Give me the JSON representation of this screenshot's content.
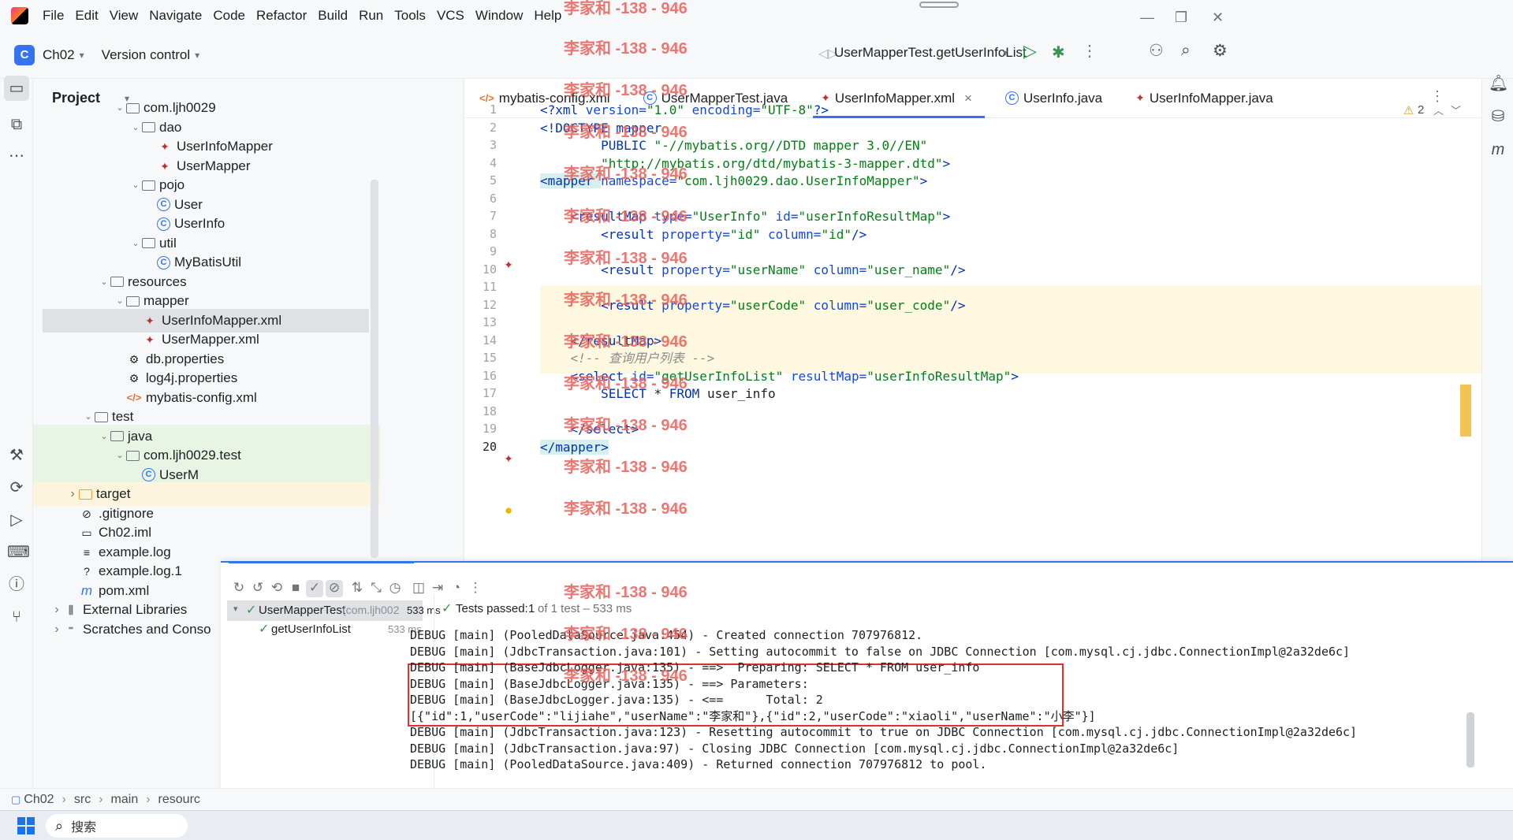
{
  "menu": [
    "File",
    "Edit",
    "View",
    "Navigate",
    "Code",
    "Refactor",
    "Build",
    "Run",
    "Tools",
    "VCS",
    "Window",
    "Help"
  ],
  "toolbar": {
    "project_badge": "C",
    "project_name": "Ch02",
    "version_control": "Version control",
    "run_config": "UserMapperTest.getUserInfoList"
  },
  "project_panel": {
    "title": "Project",
    "tree": [
      {
        "label": "com.ljh0029",
        "icon": "package",
        "arrow": "down"
      },
      {
        "label": "dao",
        "icon": "package",
        "arrow": "down"
      },
      {
        "label": "UserInfoMapper",
        "icon": "mybatis",
        "arrow": ""
      },
      {
        "label": "UserMapper",
        "icon": "mybatis",
        "arrow": ""
      },
      {
        "label": "pojo",
        "icon": "package",
        "arrow": "down"
      },
      {
        "label": "User",
        "icon": "class",
        "arrow": ""
      },
      {
        "label": "UserInfo",
        "icon": "class",
        "arrow": ""
      },
      {
        "label": "util",
        "icon": "package",
        "arrow": "down"
      },
      {
        "label": "MyBatisUtil",
        "icon": "class",
        "arrow": ""
      },
      {
        "label": "resources",
        "icon": "folder",
        "arrow": "down"
      },
      {
        "label": "mapper",
        "icon": "folder",
        "arrow": "down"
      },
      {
        "label": "UserInfoMapper.xml",
        "icon": "mybatis",
        "arrow": ""
      },
      {
        "label": "UserMapper.xml",
        "icon": "mybatis",
        "arrow": ""
      },
      {
        "label": "db.properties",
        "icon": "gear",
        "arrow": ""
      },
      {
        "label": "log4j.properties",
        "icon": "gear",
        "arrow": ""
      },
      {
        "label": "mybatis-config.xml",
        "icon": "xml",
        "arrow": ""
      },
      {
        "label": "test",
        "icon": "folder",
        "arrow": "down"
      },
      {
        "label": "java",
        "icon": "folder",
        "arrow": "down"
      },
      {
        "label": "com.ljh0029.test",
        "icon": "package",
        "arrow": "down"
      },
      {
        "label": "UserM",
        "icon": "class",
        "arrow": ""
      },
      {
        "label": "target",
        "icon": "folder-orange",
        "arrow": "right"
      },
      {
        "label": ".gitignore",
        "icon": "ignore",
        "arrow": ""
      },
      {
        "label": "Ch02.iml",
        "icon": "file",
        "arrow": ""
      },
      {
        "label": "example.log",
        "icon": "lines",
        "arrow": ""
      },
      {
        "label": "example.log.1",
        "icon": "unknown",
        "arrow": ""
      },
      {
        "label": "pom.xml",
        "icon": "maven",
        "arrow": ""
      },
      {
        "label": "External Libraries",
        "icon": "library",
        "arrow": "right"
      },
      {
        "label": "Scratches and Conso",
        "icon": "scratch",
        "arrow": "right"
      }
    ]
  },
  "tabs": [
    {
      "label": "mybatis-config.xml",
      "icon": "</>"
    },
    {
      "label": "UserMapperTest.java",
      "icon": "C"
    },
    {
      "label": "UserInfoMapper.xml",
      "icon": "bird",
      "active": true,
      "close": "×"
    },
    {
      "label": "UserInfo.java",
      "icon": "C"
    },
    {
      "label": "UserInfoMapper.java",
      "icon": "bird"
    }
  ],
  "inspection": {
    "count": "2"
  },
  "code": [
    {
      "n": "1",
      "parts": [
        [
          "t-tag",
          "<?xml "
        ],
        [
          "t-attr",
          "version="
        ],
        [
          "t-val",
          "\"1.0\" "
        ],
        [
          "t-attr",
          "encoding="
        ],
        [
          "t-val",
          "\"UTF-8\""
        ],
        [
          "t-tag",
          "?>"
        ]
      ]
    },
    {
      "n": "2",
      "parts": [
        [
          "t-tag",
          "<!DOCTYPE mapper"
        ]
      ]
    },
    {
      "n": "3",
      "parts": [
        [
          "",
          "        "
        ],
        [
          "t-tag",
          "PUBLIC "
        ],
        [
          "t-val",
          "\"-//mybatis.org//DTD mapper 3.0//EN\""
        ]
      ]
    },
    {
      "n": "4",
      "parts": [
        [
          "",
          "        "
        ],
        [
          "t-val",
          "\"http://mybatis.org/dtd/mybatis-3-mapper.dtd\""
        ],
        [
          "t-tag",
          ">"
        ]
      ]
    },
    {
      "n": "5",
      "parts": [
        [
          "t-tag",
          "<mapper "
        ],
        [
          "t-attr",
          "namespace="
        ],
        [
          "t-val",
          "\"com.ljh0029.dao.UserInfoMapper\""
        ],
        [
          "t-tag",
          ">"
        ]
      ]
    },
    {
      "n": "6",
      "parts": []
    },
    {
      "n": "7",
      "parts": [
        [
          "",
          "    "
        ],
        [
          "t-tag",
          "<resultMap "
        ],
        [
          "t-attr",
          "type="
        ],
        [
          "t-val",
          "\"UserInfo\" "
        ],
        [
          "t-attr",
          "id="
        ],
        [
          "t-val",
          "\"userInfoResultMap\""
        ],
        [
          "t-tag",
          ">"
        ]
      ]
    },
    {
      "n": "8",
      "parts": [
        [
          "",
          "        "
        ],
        [
          "t-tag",
          "<result "
        ],
        [
          "t-attr",
          "property="
        ],
        [
          "t-val",
          "\"id\" "
        ],
        [
          "t-attr",
          "column="
        ],
        [
          "t-val",
          "\"id\""
        ],
        [
          "t-tag",
          "/>"
        ]
      ]
    },
    {
      "n": "9",
      "parts": []
    },
    {
      "n": "10",
      "parts": [
        [
          "",
          "        "
        ],
        [
          "t-tag",
          "<result "
        ],
        [
          "t-attr",
          "property="
        ],
        [
          "t-val",
          "\"userName\" "
        ],
        [
          "t-attr",
          "column="
        ],
        [
          "t-val",
          "\"user_name\""
        ],
        [
          "t-tag",
          "/>"
        ]
      ]
    },
    {
      "n": "11",
      "parts": []
    },
    {
      "n": "12",
      "parts": [
        [
          "",
          "        "
        ],
        [
          "t-tag",
          "<result "
        ],
        [
          "t-attr",
          "property="
        ],
        [
          "t-val",
          "\"userCode\" "
        ],
        [
          "t-attr",
          "column="
        ],
        [
          "t-val",
          "\"user_code\""
        ],
        [
          "t-tag",
          "/>"
        ]
      ]
    },
    {
      "n": "13",
      "parts": []
    },
    {
      "n": "14",
      "parts": [
        [
          "",
          "    "
        ],
        [
          "t-tag",
          "</resultMap>"
        ]
      ]
    },
    {
      "n": "15",
      "parts": [
        [
          "",
          "    "
        ],
        [
          "t-cm",
          "<!-- 查询用户列表 -->"
        ]
      ]
    },
    {
      "n": "16",
      "parts": [
        [
          "",
          "    "
        ],
        [
          "t-tag",
          "<select "
        ],
        [
          "t-attr",
          "id="
        ],
        [
          "t-val",
          "\"getUserInfoList\" "
        ],
        [
          "t-attr",
          "resultMap="
        ],
        [
          "t-val",
          "\"userInfoResultMap\""
        ],
        [
          "t-tag",
          ">"
        ]
      ]
    },
    {
      "n": "17",
      "parts": [
        [
          "",
          "        "
        ],
        [
          "t-kw",
          "SELECT "
        ],
        [
          "",
          "* "
        ],
        [
          "t-kw",
          "FROM "
        ],
        [
          "",
          "user_info"
        ]
      ]
    },
    {
      "n": "18",
      "parts": []
    },
    {
      "n": "19",
      "parts": [
        [
          "",
          "    "
        ],
        [
          "t-tag",
          "</select>"
        ]
      ]
    },
    {
      "n": "20",
      "parts": [
        [
          "t-tag",
          "</mapper>"
        ]
      ]
    }
  ],
  "run_panel": {
    "test_root": "UserMapperTest",
    "test_root_pkg": "(com.ljh002",
    "test_root_time": "533 ms",
    "test_child": "getUserInfoList",
    "test_child_time": "533 ms",
    "summary_prefix": "Tests passed:",
    "summary_count": "1",
    "summary_rest": "of 1 test – 533 ms",
    "console": [
      "DEBUG [main] (PooledDataSource.java:454) - Created connection 707976812.",
      "DEBUG [main] (JdbcTransaction.java:101) - Setting autocommit to false on JDBC Connection [com.mysql.cj.jdbc.ConnectionImpl@2a32de6c]",
      "DEBUG [main] (BaseJdbcLogger.java:135) - ==>  Preparing: SELECT * FROM user_info",
      "DEBUG [main] (BaseJdbcLogger.java:135) - ==> Parameters: ",
      "DEBUG [main] (BaseJdbcLogger.java:135) - <==      Total: 2",
      "[{\"id\":1,\"userCode\":\"lijiahe\",\"userName\":\"李家和\"},{\"id\":2,\"userCode\":\"xiaoli\",\"userName\":\"小李\"}]",
      "DEBUG [main] (JdbcTransaction.java:123) - Resetting autocommit to true on JDBC Connection [com.mysql.cj.jdbc.ConnectionImpl@2a32de6c]",
      "DEBUG [main] (JdbcTransaction.java:97) - Closing JDBC Connection [com.mysql.cj.jdbc.ConnectionImpl@2a32de6c]",
      "DEBUG [main] (PooledDataSource.java:409) - Returned connection 707976812 to pool."
    ]
  },
  "breadcrumb": [
    "Ch02",
    "src",
    "main",
    "resourc"
  ],
  "taskbar": {
    "search_placeholder": "搜索"
  },
  "watermark": "李家和 -138 - 946",
  "colors": {
    "accent": "#3574f0",
    "highlight_box": "#e0302a",
    "pass": "#369650"
  }
}
